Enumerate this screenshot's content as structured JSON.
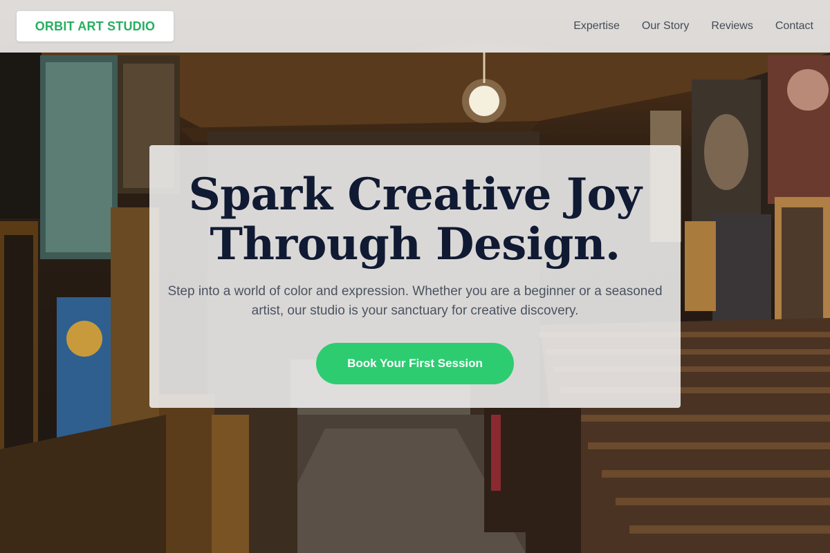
{
  "header": {
    "logo_text": "ORBIT ART STUDIO",
    "nav": [
      {
        "label": "Expertise"
      },
      {
        "label": "Our Story"
      },
      {
        "label": "Reviews"
      },
      {
        "label": "Contact"
      }
    ]
  },
  "hero": {
    "title_line1": "Spark Creative Joy",
    "title_line2": "Through Design.",
    "subtitle": "Step into a world of color and expression. Whether you are a beginner or a seasoned artist, our studio is your sanctuary for creative discovery.",
    "cta_label": "Book Your First Session"
  },
  "colors": {
    "brand_green": "#27ae60",
    "cta_green": "#2ecc71",
    "title_navy": "#111a33",
    "nav_text": "#444b55"
  }
}
